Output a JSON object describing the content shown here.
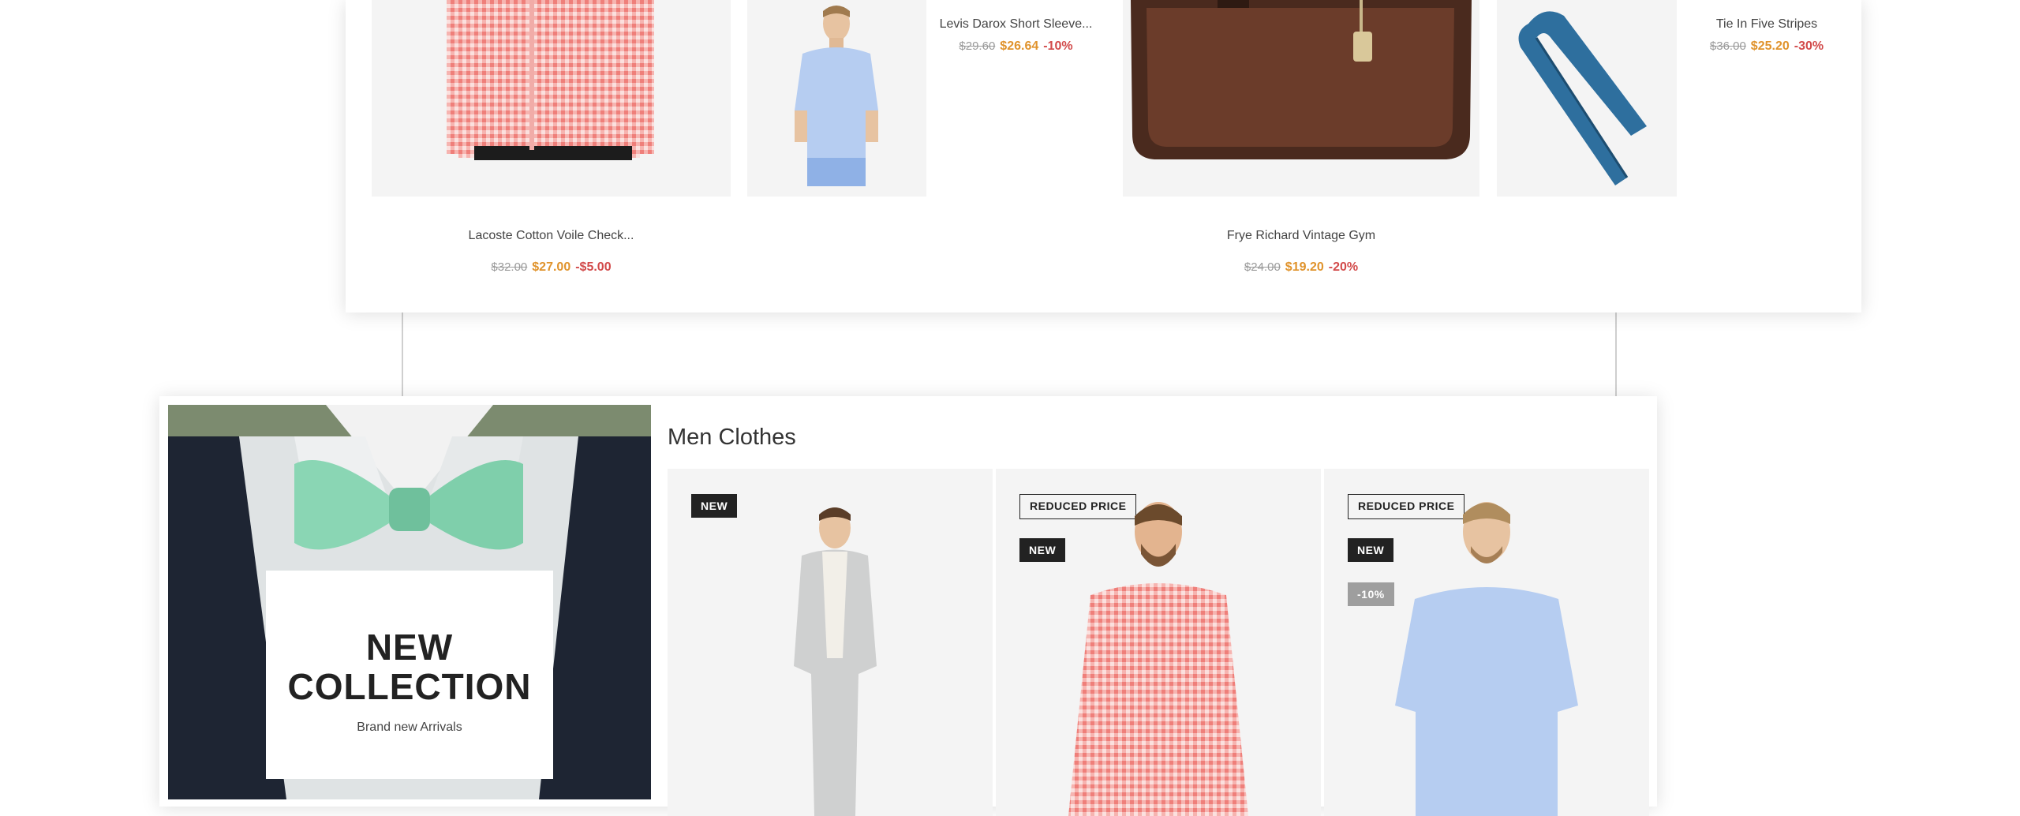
{
  "top_products": [
    {
      "name": "Lacoste Cotton Voile Check...",
      "old_price": "$32.00",
      "price": "$27.00",
      "discount": "-$5.00"
    },
    {
      "name": "Levis Darox Short Sleeve...",
      "old_price": "$29.60",
      "price": "$26.64",
      "discount": "-10%"
    },
    {
      "name": "Frye Richard Vintage Gym",
      "old_price": "$24.00",
      "price": "$19.20",
      "discount": "-20%"
    },
    {
      "name": "Tie In Five Stripes",
      "old_price": "$36.00",
      "price": "$25.20",
      "discount": "-30%"
    }
  ],
  "banner": {
    "title": "NEW COLLECTION",
    "subtitle": "Brand new Arrivals"
  },
  "section": {
    "title": "Men Clothes"
  },
  "men_products": [
    {
      "badges": [
        "NEW"
      ]
    },
    {
      "badges": [
        "REDUCED PRICE",
        "NEW"
      ]
    },
    {
      "badges": [
        "REDUCED PRICE",
        "NEW",
        "-10%"
      ]
    }
  ],
  "colors": {
    "price": "#e0932c",
    "discount": "#d24a4a",
    "badge_dark": "#222222",
    "discount_badge": "#9e9e9e"
  }
}
